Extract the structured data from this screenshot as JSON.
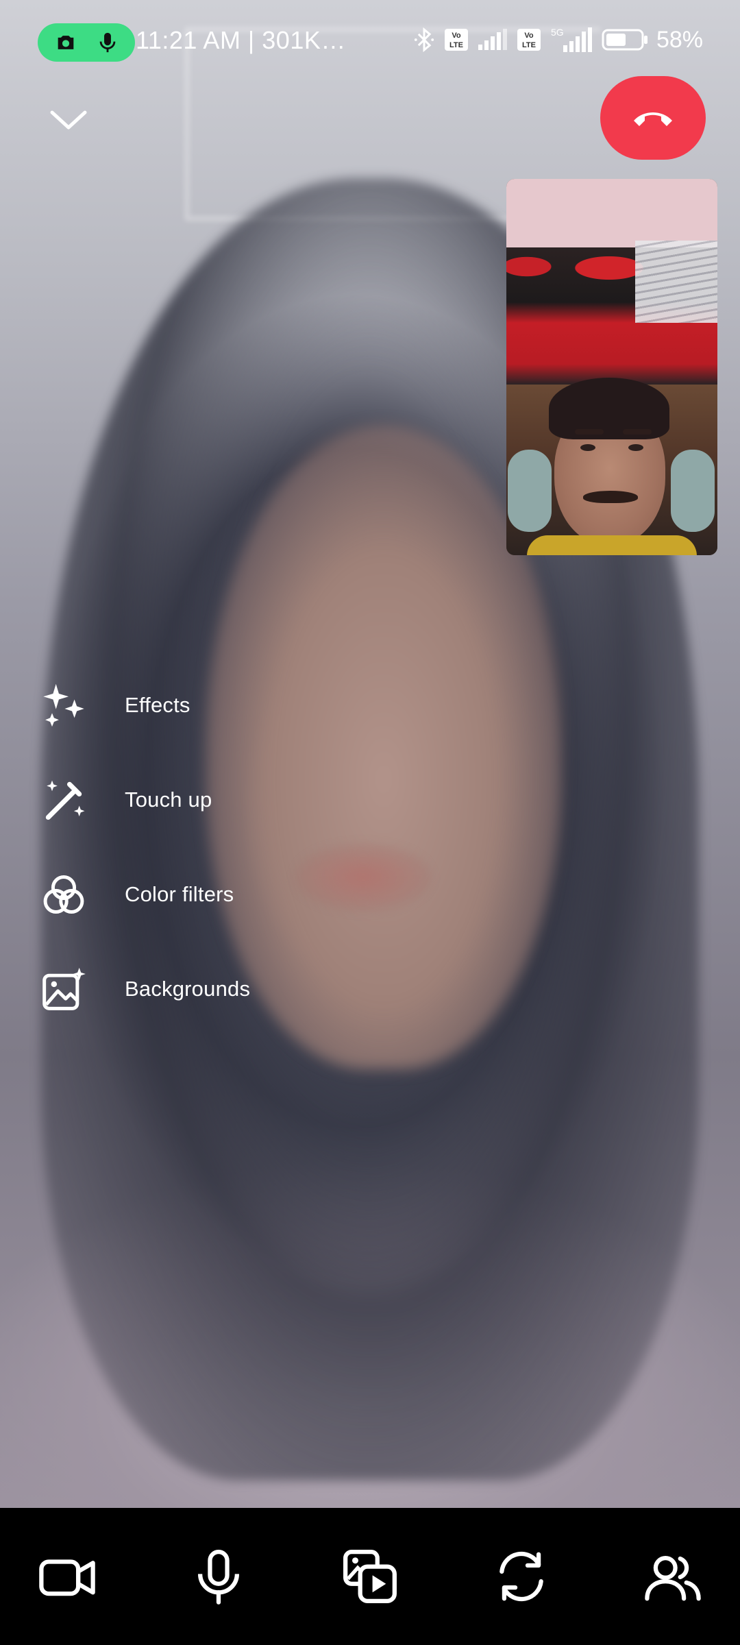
{
  "status_bar": {
    "time_text": "11:21 AM | 301K…",
    "battery_percent": "58%",
    "network_5g": "5G",
    "volte_label": "Vo LTE",
    "indicators": [
      "camera-icon",
      "mic-icon",
      "bluetooth-icon",
      "volte-icon",
      "signal-icon",
      "battery-icon"
    ]
  },
  "call": {
    "end_call_color": "#f23a4c"
  },
  "effects_menu": {
    "items": [
      {
        "label": "Effects",
        "icon": "sparkles-icon"
      },
      {
        "label": "Touch up",
        "icon": "magic-wand-icon"
      },
      {
        "label": "Color filters",
        "icon": "color-filters-icon"
      },
      {
        "label": "Backgrounds",
        "icon": "backgrounds-icon"
      }
    ]
  },
  "bottom_controls": [
    "video-camera-icon",
    "microphone-icon",
    "media-share-icon",
    "flip-camera-icon",
    "participants-icon"
  ],
  "colors": {
    "recording_pill": "#3ddc84",
    "bottom_bar": "#000000",
    "end_call": "#f23a4c"
  }
}
